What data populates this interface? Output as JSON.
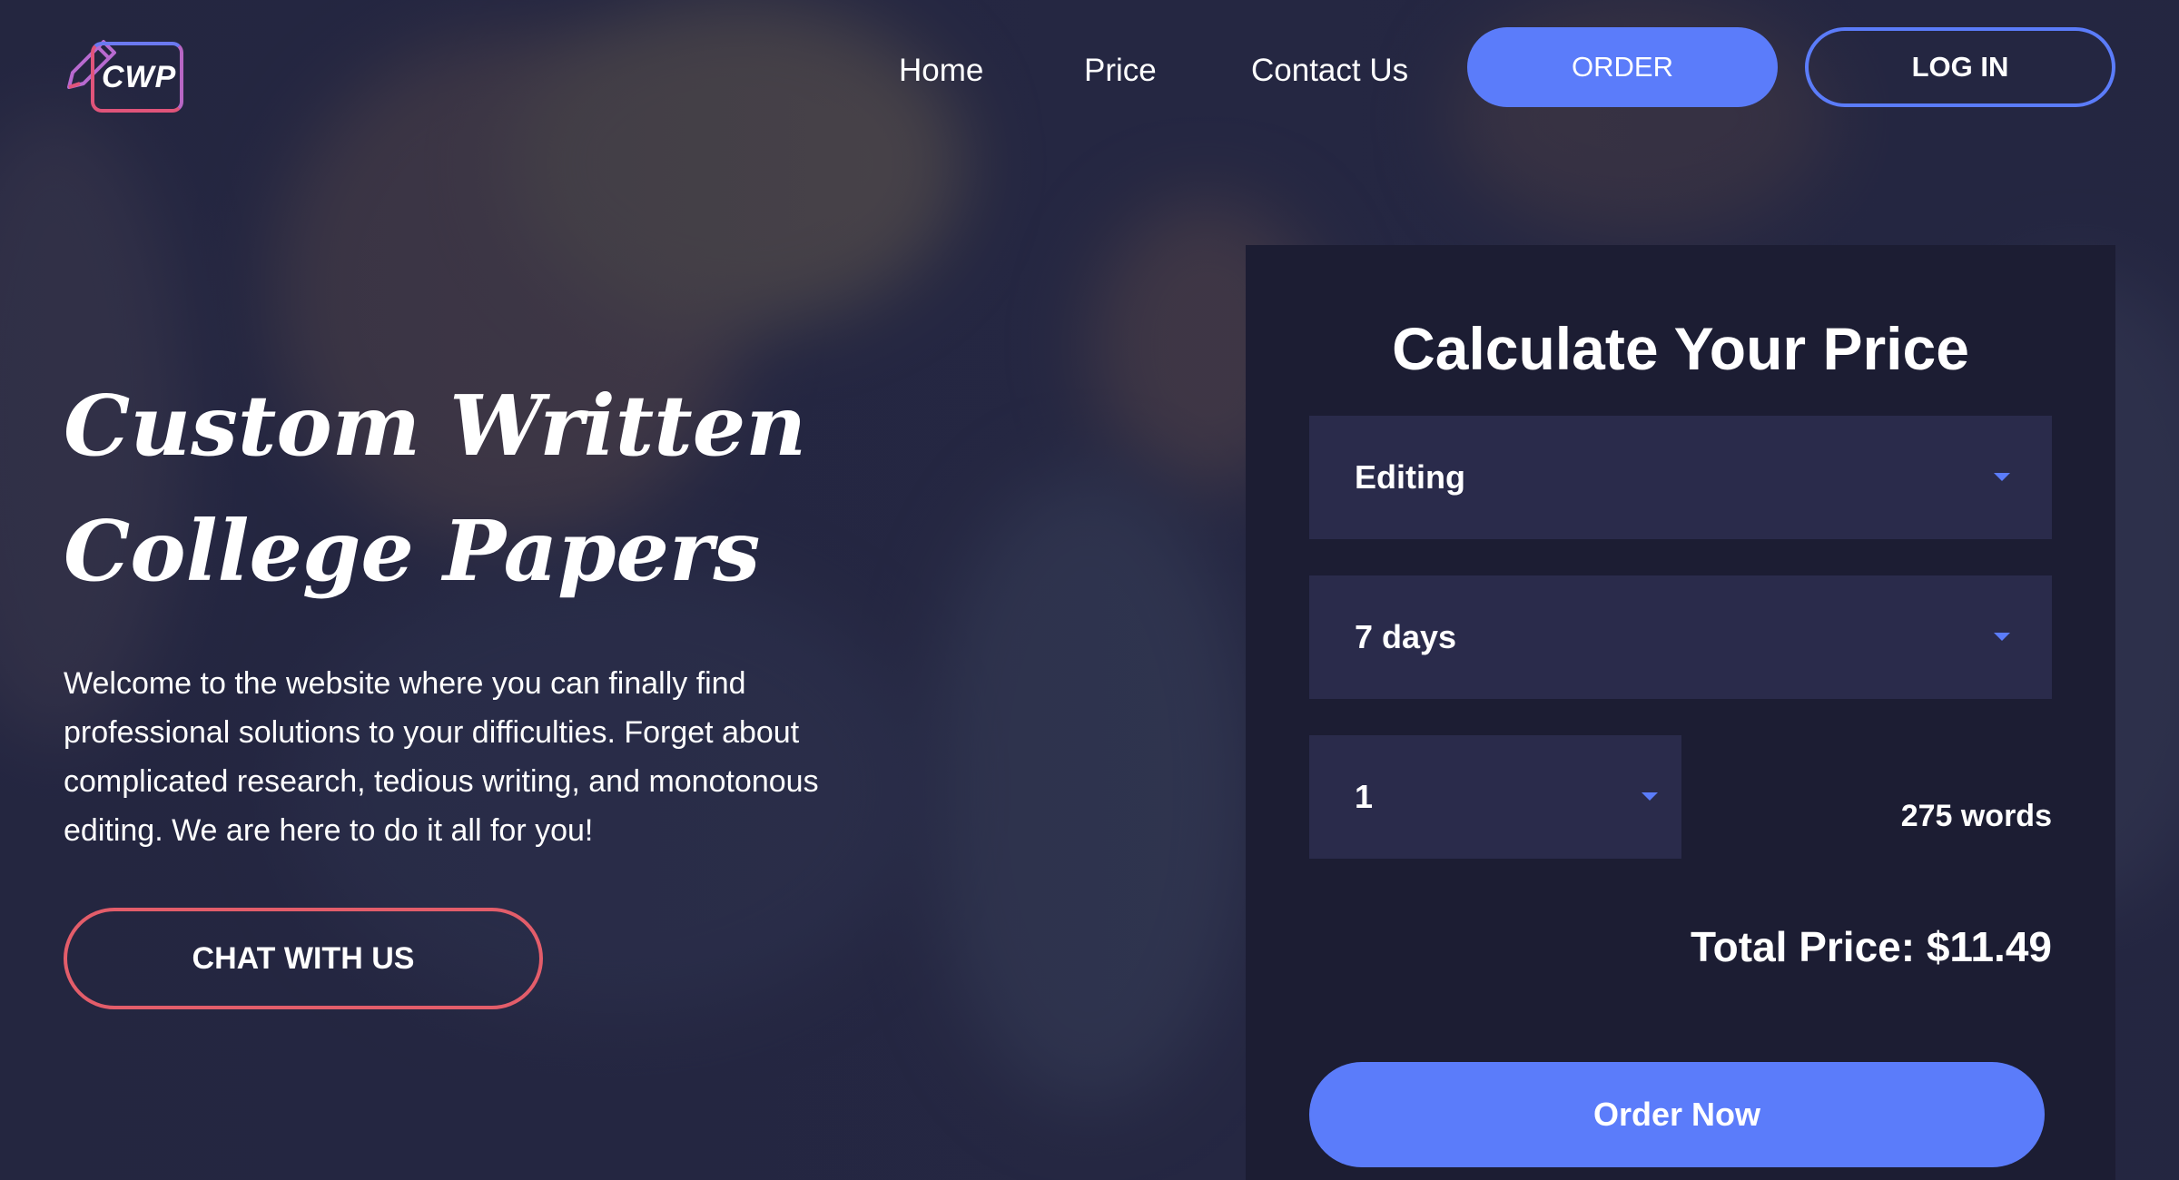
{
  "logo": {
    "text": "CWP"
  },
  "nav": {
    "links": [
      "Home",
      "Price",
      "Contact Us"
    ],
    "order_label": "ORDER",
    "login_label": "LOG IN"
  },
  "hero": {
    "title_line1": "Custom Written",
    "title_line2": "College Papers",
    "description": "Welcome to the website where you can finally find professional solutions to your difficulties. Forget about complicated research, tedious writing, and monotonous editing. We are here to do it all for you!",
    "chat_label": "CHAT WITH US"
  },
  "calculator": {
    "title": "Calculate Your Price",
    "service": "Editing",
    "deadline": "7 days",
    "pages": "1",
    "words": "275 words",
    "total": "Total Price: $11.49",
    "order_now_label": "Order Now"
  },
  "colors": {
    "accent": "#5b7cfa",
    "chat_border": "#e35d6a",
    "panel_bg": "#1c1d33",
    "select_bg": "#2a2b4b"
  },
  "icons": [
    "pen-logo-icon",
    "chevron-down-icon"
  ]
}
